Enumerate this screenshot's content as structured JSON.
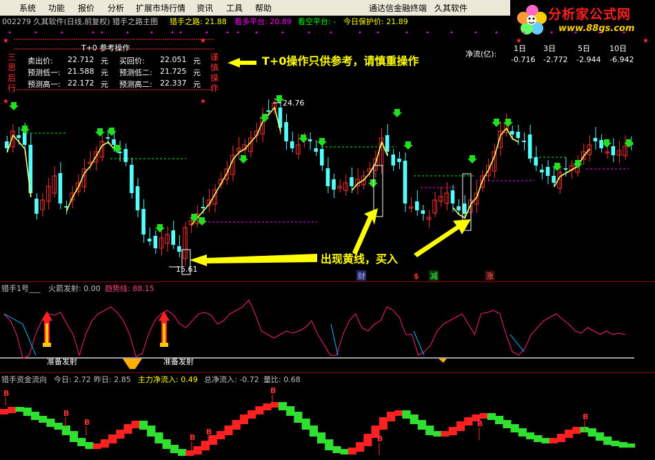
{
  "menu": {
    "items": [
      "系统",
      "功能",
      "报价",
      "分析",
      "扩展市场行情",
      "资讯",
      "工具",
      "帮助"
    ],
    "right_title": "通达信金融终端",
    "right_brand": "久其软件"
  },
  "logo": {
    "title": "分析家公式网",
    "url": "www.88gs.com"
  },
  "info": {
    "code_title": "002279 久其软件(日线,前复权) 猎手之路主图",
    "hunter_label": "猎手之路: 21.88",
    "bull_label": "看多平台: 20.89",
    "bear_label": "看空平台: -",
    "protect_label": "今日保护价: 21.89"
  },
  "t0": {
    "title": "T+0 参考操作",
    "left_vertical": [
      "三",
      "思",
      "后",
      "行"
    ],
    "right_vertical": [
      "谨",
      "慎",
      "操",
      "作"
    ],
    "rows": [
      {
        "l_label": "卖出价:",
        "l_value": "22.712",
        "l_unit": "元",
        "r_label": "买回价:",
        "r_value": "22.051",
        "r_unit": "元"
      },
      {
        "l_label": "预测低一:",
        "l_value": "21.588",
        "l_unit": "元",
        "r_label": "预测低二:",
        "r_value": "21.725",
        "r_unit": "元"
      },
      {
        "l_label": "预测高一:",
        "l_value": "22.172",
        "l_unit": "元",
        "r_label": "预测高二:",
        "r_value": "22.337",
        "r_unit": "元"
      }
    ]
  },
  "annotations": {
    "t0_note": "T+0操作只供参考，请慎重操作",
    "buy_note": "出现黄线，买入",
    "high_price": "24.76",
    "low_price": "15.61",
    "cai": "财",
    "dollar": "$",
    "jian": "减",
    "zhang": "涨"
  },
  "netflow": {
    "label": "净流(亿):",
    "headers": [
      "1日",
      "3日",
      "5日",
      "10日"
    ],
    "values": [
      "-0.716",
      "-2.772",
      "-2.944",
      "-6.942"
    ]
  },
  "panel1": {
    "name": "猎手1号___",
    "rocket_label": "火箭发射: 0.00",
    "trend_label": "趋势线: 88.15",
    "prepare1": "准备发射",
    "prepare2": "准备发射"
  },
  "panel2": {
    "name": "猎手资金流向",
    "today": "今日: 2.72",
    "yesterday": "昨日: 2.85",
    "main_inflow": "主力净流入: 0.49",
    "total_inflow": "总净流入: -0.72",
    "volume_ratio": "量比: 0.68",
    "b_marker": "B"
  },
  "colors": {
    "up": "#ff3030",
    "down": "#54fcfc",
    "yellow": "#ffff00",
    "green": "#00ff00",
    "magenta": "#ff00ff",
    "pink": "#ff4080"
  }
}
